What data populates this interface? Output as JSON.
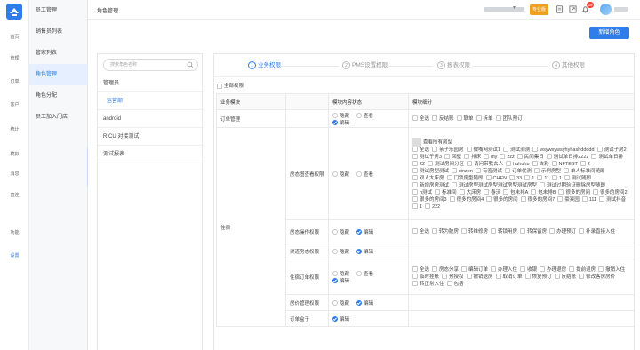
{
  "rail": [
    {
      "label": "首页",
      "icon": "home-icon"
    },
    {
      "label": "管理",
      "icon": "building-icon"
    },
    {
      "label": "订单",
      "icon": "order-icon"
    },
    {
      "label": "客户",
      "icon": "customer-icon"
    },
    {
      "label": "统计",
      "icon": "chart-icon"
    },
    {
      "label": "模拟",
      "icon": "simulate-icon"
    },
    {
      "label": "消息",
      "icon": "message-icon"
    },
    {
      "label": "直连",
      "icon": "connect-icon"
    },
    {
      "label": "功能",
      "icon": "function-icon"
    },
    {
      "label": "设置",
      "icon": "settings-icon"
    }
  ],
  "menu": [
    "员工管理",
    "销售员列表",
    "管家列表",
    "角色管理",
    "角色分配",
    "员工加入门店"
  ],
  "header": {
    "title": "角色管理",
    "badge": "专业版",
    "notif_count": "29"
  },
  "new_role_label": "新增角色",
  "role_search_placeholder": "搜索角色名称",
  "roles": [
    "管理员",
    "运营部",
    "android",
    "RICU 对接测试",
    "测试报表"
  ],
  "steps": [
    {
      "num": "1",
      "label": "业务权限"
    },
    {
      "num": "2",
      "label": "PMS设置权限"
    },
    {
      "num": "3",
      "label": "报表权限"
    },
    {
      "num": "4",
      "label": "其他权限"
    }
  ],
  "all_perm_label": "全部权限",
  "table_headers": [
    "业务模块",
    "",
    "模块内容状态",
    "模块细分"
  ],
  "status_opts": [
    "隐藏",
    "查看",
    "编辑"
  ],
  "order_module": {
    "name": "订单管理",
    "details": [
      "全选",
      "反结账",
      "联单",
      "拆单",
      "团队预订"
    ]
  },
  "live_module_name": "住宿",
  "rows": [
    {
      "name": "房态图查看权限",
      "status": [
        "隐藏",
        "查看"
      ],
      "top_label": "查看所有房型",
      "tags": [
        "全选",
        "亲子乐园房",
        "微嘴网测试1",
        "测试测测",
        "wsywsywsyhyhashddddd",
        "测试子房2",
        "测试子房3",
        "回壁",
        "排床",
        "my",
        "zzz",
        "民间集日",
        "测试单日排2222",
        "测试单日排",
        "22",
        "测试房间分区",
        "请问带我去人",
        "huhuhu",
        "古彩",
        "NFTEST",
        "2",
        "测试房型测试",
        "xinzen",
        "有密测试",
        "订单优测",
        "示例房型",
        "单人标准间随即",
        "双人大床房",
        "门锁房型随即",
        "CHEN",
        "33",
        "1",
        "11",
        "1",
        "测试随即",
        "新增房房测试",
        "测试房型测试房型测试房型测试房型",
        "测试过期验证删除房型随即",
        "h测试",
        "标准间",
        "大床房",
        "春沃",
        "包未排A",
        "包未排B",
        "很多的房间",
        "很多的房间2",
        "很多的房间3",
        "很多的房间4",
        "很多的房间",
        "很多的房间7",
        "豪宾园",
        "111",
        "测试抖音",
        "1",
        "222"
      ]
    },
    {
      "name": "房态操作权限",
      "status": [
        "隐藏",
        "编辑"
      ],
      "tags": [
        "全选",
        "转为脏房",
        "转维修房",
        "转锁用房",
        "转保留房",
        "办理预订",
        "补录直接入住"
      ]
    },
    {
      "name": "渠道房态权限",
      "status": [
        "隐藏",
        "编辑"
      ],
      "tags": []
    },
    {
      "name": "住宿订单权限",
      "status": [
        "隐藏",
        "查看",
        "编辑"
      ],
      "tags": [
        "全选",
        "房态分享",
        "编辑订单",
        "办理入住",
        "收银",
        "办理退房",
        "提前退房",
        "撤销入住",
        "临时挂账",
        "预授权",
        "撤销退房",
        "取消订单",
        "恢复预订",
        "反结账",
        "修改客房房价",
        "转正常入住",
        "包括"
      ]
    },
    {
      "name": "房价管理权限",
      "status": [
        "隐藏",
        "编辑"
      ],
      "tags": []
    },
    {
      "name": "订单盒子",
      "status": [
        "编辑"
      ],
      "tags": []
    }
  ]
}
